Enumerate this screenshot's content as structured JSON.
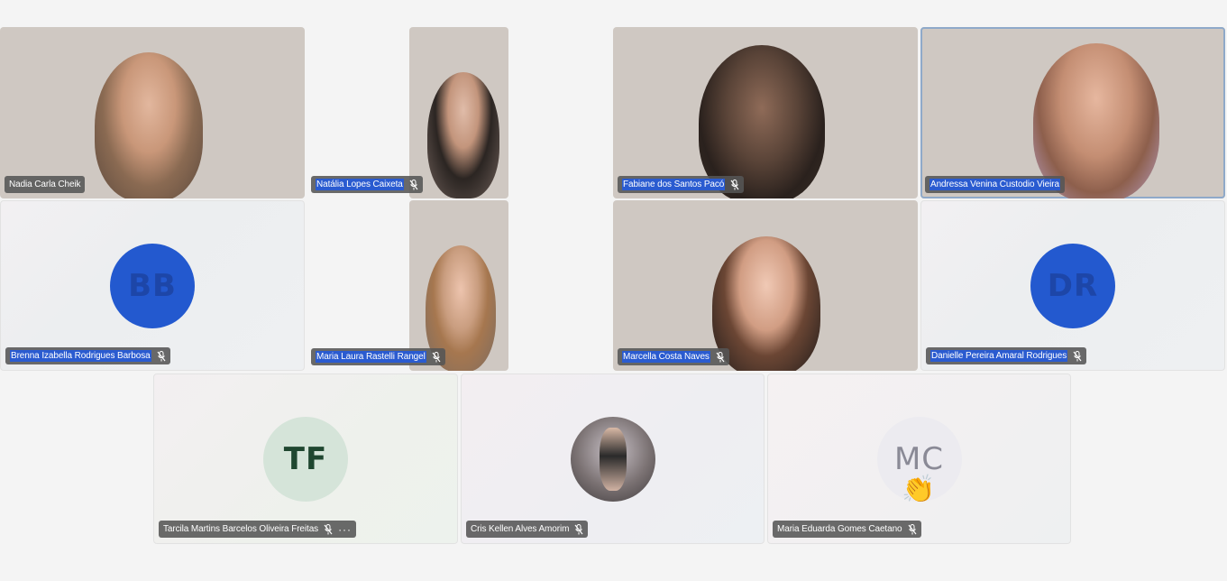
{
  "participants": [
    {
      "name": "Nadia Carla Cheik",
      "muted": false
    },
    {
      "name": "Natália Lopes Caixeta",
      "muted": true
    },
    {
      "name": "Fabiane dos Santos Pacó",
      "muted": true
    },
    {
      "name": "Andressa Venina Custodio Vieira",
      "muted": false
    },
    {
      "name": "Brenna Izabella Rodrigues Barbosa",
      "muted": true,
      "initials": "BB"
    },
    {
      "name": "Maria Laura Rastelli Rangel",
      "muted": true
    },
    {
      "name": "Marcella Costa Naves",
      "muted": true
    },
    {
      "name": "Danielle Pereira Amaral Rodrigues",
      "muted": true,
      "initials": "DR"
    },
    {
      "name": "Tarcila Martins Barcelos Oliveira Freitas",
      "muted": true,
      "initials": "TF",
      "more": "···"
    },
    {
      "name": "Cris Kellen Alves Amorim",
      "muted": true
    },
    {
      "name": "Maria Eduarda Gomes Caetano",
      "muted": true,
      "initials": "MC",
      "reaction": "👏"
    }
  ],
  "icons": {
    "muted": "mic-off-icon",
    "more": "more-options-icon",
    "reaction": "clap-icon"
  },
  "colors": {
    "avatar_blue": "#2359cf",
    "avatar_green": "#d5e4d9",
    "avatar_grey": "#ecebf0",
    "highlight": "#2a5bd0"
  }
}
